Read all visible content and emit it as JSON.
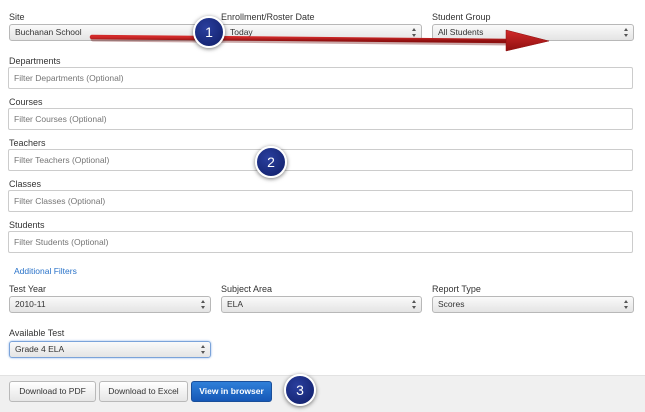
{
  "filters": {
    "site": {
      "label": "Site",
      "value": "Buchanan School"
    },
    "enrollment_date": {
      "label": "Enrollment/Roster Date",
      "value": "Today"
    },
    "student_group": {
      "label": "Student Group",
      "value": "All Students"
    },
    "departments": {
      "label": "Departments",
      "placeholder": "Filter Departments (Optional)"
    },
    "courses": {
      "label": "Courses",
      "placeholder": "Filter Courses (Optional)"
    },
    "teachers": {
      "label": "Teachers",
      "placeholder": "Filter Teachers (Optional)"
    },
    "classes": {
      "label": "Classes",
      "placeholder": "Filter Classes (Optional)"
    },
    "students": {
      "label": "Students",
      "placeholder": "Filter Students (Optional)"
    },
    "additional_filters_link": "Additional Filters",
    "test_year": {
      "label": "Test Year",
      "value": "2010-11"
    },
    "subject_area": {
      "label": "Subject Area",
      "value": "ELA"
    },
    "report_type": {
      "label": "Report Type",
      "value": "Scores"
    },
    "available_test": {
      "label": "Available Test",
      "value": "Grade 4 ELA"
    }
  },
  "actions": {
    "download_pdf": "Download to PDF",
    "download_excel": "Download to Excel",
    "view_browser": "View in browser"
  },
  "callouts": [
    "1",
    "2",
    "3"
  ],
  "colors": {
    "arrow": "#b01818",
    "callout": "#1a2b80",
    "link": "#2a73c9",
    "primary_button": "#1d66c7"
  },
  "icons": {
    "select_arrows": "updown-arrows-icon",
    "callout_arrow": "arrow-right-icon"
  }
}
